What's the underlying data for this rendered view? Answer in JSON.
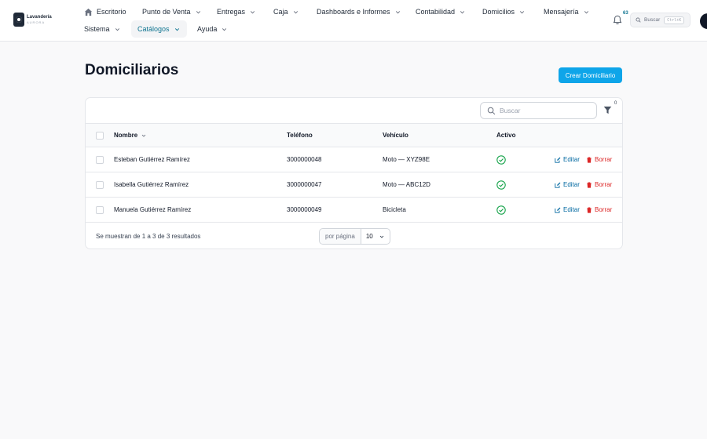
{
  "brand": {
    "name": "Lavandería",
    "sub": "AURORA"
  },
  "nav": {
    "items": [
      {
        "label": "Escritorio"
      },
      {
        "label": "Punto de Venta"
      },
      {
        "label": "Entregas"
      },
      {
        "label": "Caja"
      },
      {
        "label": "Dashboards e Informes"
      },
      {
        "label": "Contabilidad"
      },
      {
        "label": "Domicilios"
      },
      {
        "label": "Mensajería"
      },
      {
        "label": "Sistema"
      },
      {
        "label": "Catálogos"
      },
      {
        "label": "Ayuda"
      }
    ],
    "active": "Catálogos",
    "notifications_count": "63",
    "search_label": "Buscar",
    "search_shortcut": "Ctrl+K"
  },
  "page": {
    "title": "Domiciliarios",
    "create_button": "Crear Domiciliario"
  },
  "table": {
    "search_placeholder": "Buscar",
    "filter_count": "0",
    "columns": {
      "name": "Nombre",
      "phone": "Teléfono",
      "vehicle": "Vehículo",
      "active": "Activo"
    },
    "rows": [
      {
        "name": "Esteban Gutiérrez Ramírez",
        "phone": "3000000048",
        "vehicle": "Moto — XYZ98E",
        "active": true
      },
      {
        "name": "Isabella Gutiérrez Ramírez",
        "phone": "3000000047",
        "vehicle": "Moto — ABC12D",
        "active": true
      },
      {
        "name": "Manuela Gutiérrez Ramírez",
        "phone": "3000000049",
        "vehicle": "Bicicleta",
        "active": true
      }
    ],
    "edit_label": "Editar",
    "delete_label": "Borrar",
    "footer_text": "Se muestran de 1 a 3 de 3 resultados",
    "per_page_label": "por página",
    "per_page_value": "10"
  },
  "colors": {
    "accent": "#0ea5e9",
    "link": "#0369a1",
    "danger": "#dc2626",
    "success": "#16a34a"
  },
  "icons": [
    "home-icon",
    "chevron-down-icon",
    "bell-icon",
    "search-icon",
    "filter-icon",
    "check-circle-icon",
    "edit-icon",
    "trash-icon"
  ]
}
